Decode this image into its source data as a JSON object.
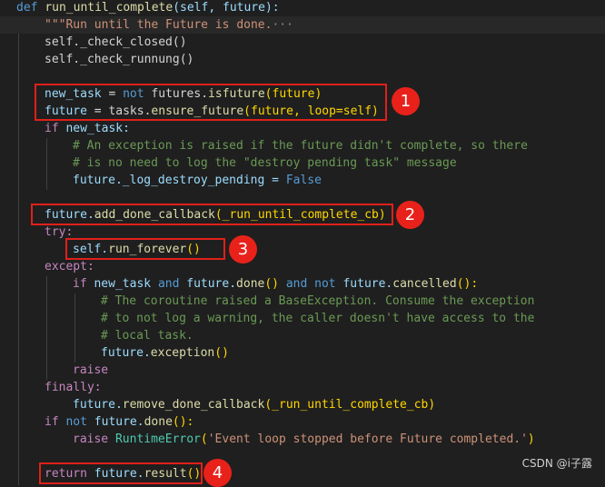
{
  "lines": {
    "l1_def": "def",
    "l1_name": "run_until_complete",
    "l1_args": "(self, future):",
    "l2_doc": "\"\"\"Run until the Future is done.",
    "l2_fold": "···",
    "l3": "self._check_closed()",
    "l4": "self._check_runnung()",
    "l6_a": "new_task",
    "l6_b": " = ",
    "l6_c": "not",
    "l6_d": " futures.",
    "l6_e": "isfuture",
    "l6_f": "(future)",
    "l7_a": "future",
    "l7_b": " = tasks.",
    "l7_c": "ensure_future",
    "l7_d": "(future, loop=self)",
    "l8_a": "if",
    "l8_b": " new_task:",
    "l9": "# An exception is raised if the future didn't complete, so there",
    "l10": "# is no need to log the \"destroy pending task\" message",
    "l11_a": "future._log_destroy_pending = ",
    "l11_b": "False",
    "l13_a": "future.",
    "l13_b": "add_done_callback",
    "l13_c": "(_run_until_complete_cb)",
    "l14": "try:",
    "l15_a": "self.",
    "l15_b": "run_forever",
    "l15_c": "()",
    "l16": "except:",
    "l17_a": "if",
    "l17_b": " new_task ",
    "l17_c": "and",
    "l17_d": " future.",
    "l17_e": "done",
    "l17_f": "() ",
    "l17_g": "and",
    "l17_h": " not",
    "l17_i": " future.",
    "l17_j": "cancelled",
    "l17_k": "():",
    "l18": "# The coroutine raised a BaseException. Consume the exception",
    "l19": "# to not log a warning, the caller doesn't have access to the",
    "l20": "# local task.",
    "l21_a": "future.",
    "l21_b": "exception",
    "l21_c": "()",
    "l22": "raise",
    "l23": "finally:",
    "l24_a": "future.",
    "l24_b": "remove_done_callback",
    "l24_c": "(_run_until_complete_cb)",
    "l25_a": "if",
    "l25_b": " not",
    "l25_c": " future.",
    "l25_d": "done",
    "l25_e": "():",
    "l26_a": "raise",
    "l26_b": "RuntimeError",
    "l26_c": "(",
    "l26_d": "'Event loop stopped before Future completed.'",
    "l26_e": ")",
    "l28_a": "return",
    "l28_b": " future.",
    "l28_c": "result",
    "l28_d": "()"
  },
  "badges": [
    "1",
    "2",
    "3",
    "4"
  ],
  "watermark": "CSDN @i子露",
  "colors": {
    "background": "#1f1f1f",
    "keyword": "#569cd6",
    "control": "#c586c0",
    "function": "#dcdcaa",
    "variable": "#9cdcfe",
    "string": "#ce9178",
    "comment": "#6a9955",
    "annotation_red": "#e0201a"
  }
}
